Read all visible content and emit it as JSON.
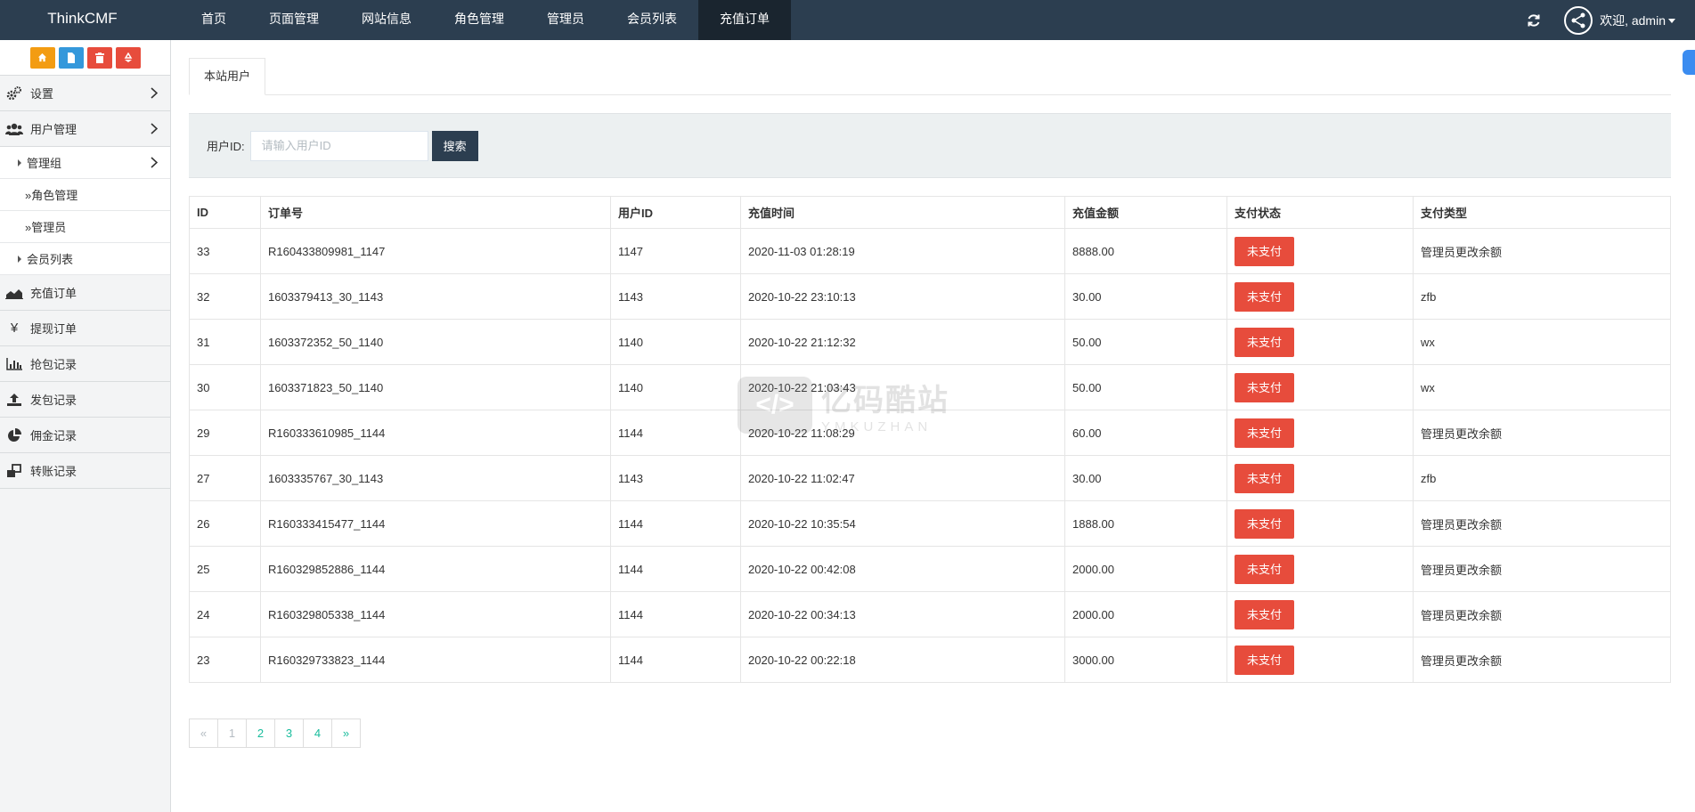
{
  "brand": "ThinkCMF",
  "nav": [
    "首页",
    "页面管理",
    "网站信息",
    "角色管理",
    "管理员",
    "会员列表",
    "充值订单"
  ],
  "nav_active": 6,
  "user": {
    "welcome": "欢迎, admin"
  },
  "quick_buttons": [
    {
      "icon": "home-icon",
      "color": "#f39c12"
    },
    {
      "icon": "file-icon",
      "color": "#3498db"
    },
    {
      "icon": "trash-icon",
      "color": "#e74c3c"
    },
    {
      "icon": "recycle-icon",
      "color": "#e74c3c"
    }
  ],
  "sidebar": {
    "settings": "设置",
    "user_mgmt": "用户管理",
    "admin_group": "管理组",
    "role_mgmt": "»角色管理",
    "admin": "»管理员",
    "member_list": "会员列表",
    "items": [
      "充值订单",
      "提现订单",
      "抢包记录",
      "发包记录",
      "佣金记录",
      "转账记录"
    ]
  },
  "tab": "本站用户",
  "search": {
    "label": "用户ID:",
    "placeholder": "请输入用户ID",
    "button": "搜索"
  },
  "table": {
    "headers": [
      "ID",
      "订单号",
      "用户ID",
      "充值时间",
      "充值金额",
      "支付状态",
      "支付类型"
    ],
    "rows": [
      [
        "33",
        "R160433809981_1147",
        "1147",
        "2020-11-03 01:28:19",
        "8888.00",
        "未支付",
        "管理员更改余额"
      ],
      [
        "32",
        "1603379413_30_1143",
        "1143",
        "2020-10-22 23:10:13",
        "30.00",
        "未支付",
        "zfb"
      ],
      [
        "31",
        "1603372352_50_1140",
        "1140",
        "2020-10-22 21:12:32",
        "50.00",
        "未支付",
        "wx"
      ],
      [
        "30",
        "1603371823_50_1140",
        "1140",
        "2020-10-22 21:03:43",
        "50.00",
        "未支付",
        "wx"
      ],
      [
        "29",
        "R160333610985_1144",
        "1144",
        "2020-10-22 11:08:29",
        "60.00",
        "未支付",
        "管理员更改余额"
      ],
      [
        "27",
        "1603335767_30_1143",
        "1143",
        "2020-10-22 11:02:47",
        "30.00",
        "未支付",
        "zfb"
      ],
      [
        "26",
        "R160333415477_1144",
        "1144",
        "2020-10-22 10:35:54",
        "1888.00",
        "未支付",
        "管理员更改余额"
      ],
      [
        "25",
        "R160329852886_1144",
        "1144",
        "2020-10-22 00:42:08",
        "2000.00",
        "未支付",
        "管理员更改余额"
      ],
      [
        "24",
        "R160329805338_1144",
        "1144",
        "2020-10-22 00:34:13",
        "2000.00",
        "未支付",
        "管理员更改余额"
      ],
      [
        "23",
        "R160329733823_1144",
        "1144",
        "2020-10-22 00:22:18",
        "3000.00",
        "未支付",
        "管理员更改余额"
      ]
    ]
  },
  "pagination": [
    "«",
    "1",
    "2",
    "3",
    "4",
    "»"
  ],
  "watermark": {
    "cn": "亿码酷站",
    "en": "YMKUZHAN"
  },
  "colors": {
    "topbar": "#2c3e50",
    "status_unpaid": "#e74c3c",
    "link": "#18bc9c"
  }
}
